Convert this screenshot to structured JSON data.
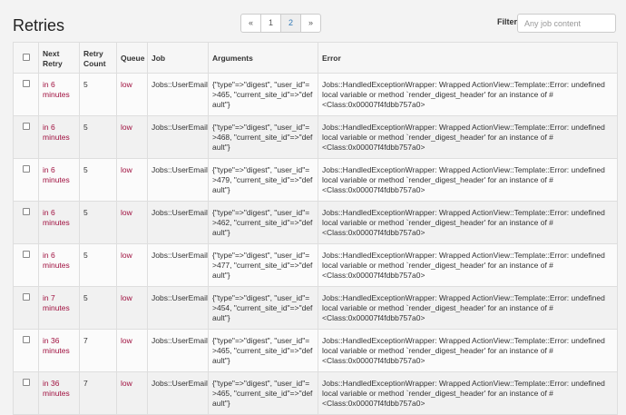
{
  "header": {
    "title": "Retries",
    "filter_label": "Filter",
    "filter_placeholder": "Any job content"
  },
  "pagination": {
    "prev": "«",
    "pages": [
      "1",
      "2"
    ],
    "current": "2",
    "next": "»"
  },
  "table": {
    "columns": [
      "",
      "Next Retry",
      "Retry Count",
      "Queue",
      "Job",
      "Arguments",
      "Error"
    ],
    "rows": [
      {
        "next_retry": "in 6 minutes",
        "retry_count": "5",
        "queue": "low",
        "job": "Jobs::UserEmail",
        "arguments": "{\"type\"=>\"digest\", \"user_id\"=>465, \"current_site_id\"=>\"default\"}",
        "error": "Jobs::HandledExceptionWrapper: Wrapped ActionView::Template::Error: undefined local variable or method `render_digest_header' for an instance of #<Class:0x00007f4fdbb757a0>"
      },
      {
        "next_retry": "in 6 minutes",
        "retry_count": "5",
        "queue": "low",
        "job": "Jobs::UserEmail",
        "arguments": "{\"type\"=>\"digest\", \"user_id\"=>468, \"current_site_id\"=>\"default\"}",
        "error": "Jobs::HandledExceptionWrapper: Wrapped ActionView::Template::Error: undefined local variable or method `render_digest_header' for an instance of #<Class:0x00007f4fdbb757a0>"
      },
      {
        "next_retry": "in 6 minutes",
        "retry_count": "5",
        "queue": "low",
        "job": "Jobs::UserEmail",
        "arguments": "{\"type\"=>\"digest\", \"user_id\"=>479, \"current_site_id\"=>\"default\"}",
        "error": "Jobs::HandledExceptionWrapper: Wrapped ActionView::Template::Error: undefined local variable or method `render_digest_header' for an instance of #<Class:0x00007f4fdbb757a0>"
      },
      {
        "next_retry": "in 6 minutes",
        "retry_count": "5",
        "queue": "low",
        "job": "Jobs::UserEmail",
        "arguments": "{\"type\"=>\"digest\", \"user_id\"=>462, \"current_site_id\"=>\"default\"}",
        "error": "Jobs::HandledExceptionWrapper: Wrapped ActionView::Template::Error: undefined local variable or method `render_digest_header' for an instance of #<Class:0x00007f4fdbb757a0>"
      },
      {
        "next_retry": "in 6 minutes",
        "retry_count": "5",
        "queue": "low",
        "job": "Jobs::UserEmail",
        "arguments": "{\"type\"=>\"digest\", \"user_id\"=>477, \"current_site_id\"=>\"default\"}",
        "error": "Jobs::HandledExceptionWrapper: Wrapped ActionView::Template::Error: undefined local variable or method `render_digest_header' for an instance of #<Class:0x00007f4fdbb757a0>"
      },
      {
        "next_retry": "in 7 minutes",
        "retry_count": "5",
        "queue": "low",
        "job": "Jobs::UserEmail",
        "arguments": "{\"type\"=>\"digest\", \"user_id\"=>454, \"current_site_id\"=>\"default\"}",
        "error": "Jobs::HandledExceptionWrapper: Wrapped ActionView::Template::Error: undefined local variable or method `render_digest_header' for an instance of #<Class:0x00007f4fdbb757a0>"
      },
      {
        "next_retry": "in 36 minutes",
        "retry_count": "7",
        "queue": "low",
        "job": "Jobs::UserEmail",
        "arguments": "{\"type\"=>\"digest\", \"user_id\"=>465, \"current_site_id\"=>\"default\"}",
        "error": "Jobs::HandledExceptionWrapper: Wrapped ActionView::Template::Error: undefined local variable or method `render_digest_header' for an instance of #<Class:0x00007f4fdbb757a0>"
      },
      {
        "next_retry": "in 36 minutes",
        "retry_count": "7",
        "queue": "low",
        "job": "Jobs::UserEmail",
        "arguments": "{\"type\"=>\"digest\", \"user_id\"=>465, \"current_site_id\"=>\"default\"}",
        "error": "Jobs::HandledExceptionWrapper: Wrapped ActionView::Template::Error: undefined local variable or method `render_digest_header' for an instance of #<Class:0x00007f4fdbb757a0>"
      }
    ]
  }
}
